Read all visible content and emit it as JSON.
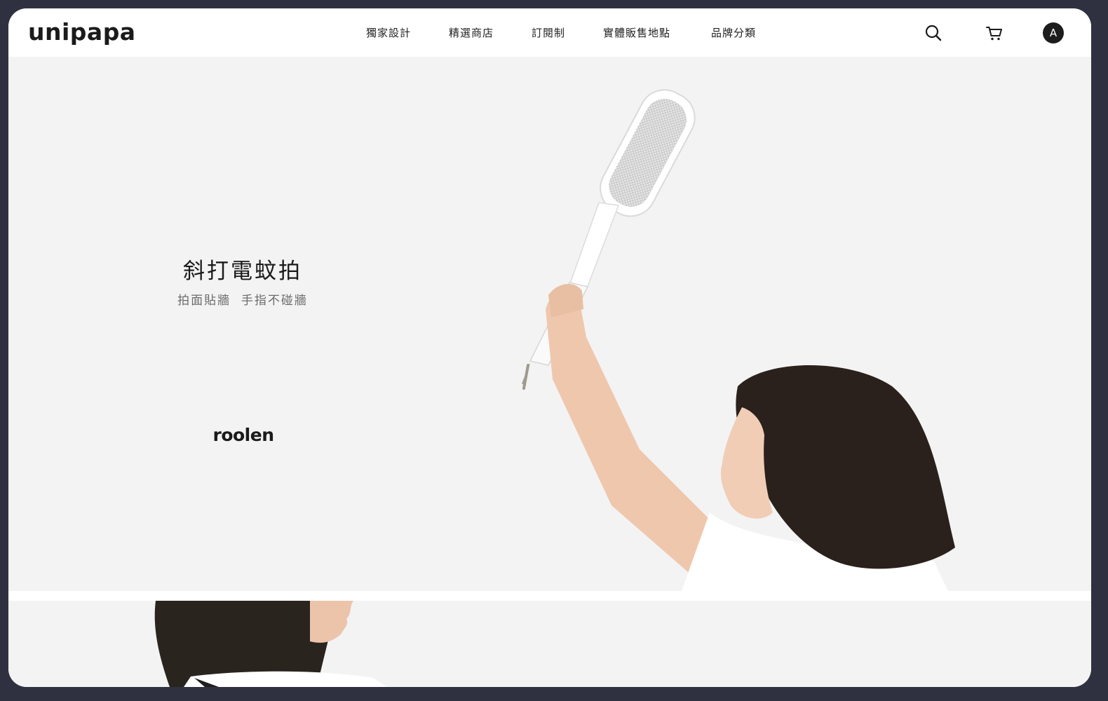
{
  "header": {
    "logo": "unipapa",
    "nav": [
      {
        "label": "獨家設計"
      },
      {
        "label": "精選商店"
      },
      {
        "label": "訂閱制"
      },
      {
        "label": "實體販售地點"
      },
      {
        "label": "品牌分類"
      }
    ],
    "icons": {
      "search": "search-icon",
      "cart": "cart-icon"
    },
    "avatar_initial": "A"
  },
  "hero": {
    "title": "斜打電蚊拍",
    "subtitle": "拍面貼牆  手指不碰牆",
    "brand": "roolen"
  },
  "colors": {
    "background": "#f3f3f3",
    "header": "#ffffff",
    "frame": "#2f3140",
    "text": "#1a1a1a"
  }
}
